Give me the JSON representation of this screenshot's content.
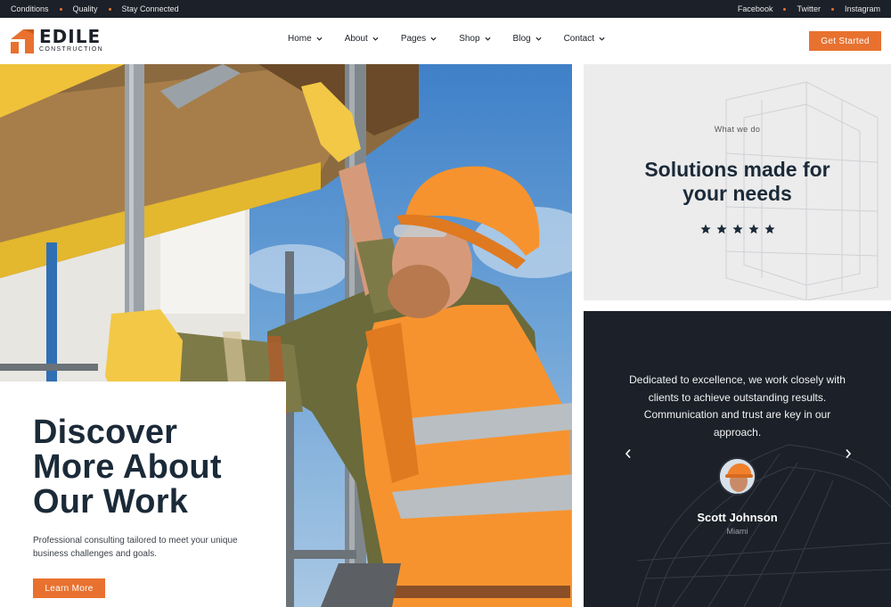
{
  "topbar": {
    "left_links": [
      "Conditions",
      "Quality",
      "Stay Connected"
    ],
    "right_links": [
      "Facebook",
      "Twitter",
      "Instagram"
    ]
  },
  "brand": {
    "name": "EDILE",
    "tagline": "CONSTRUCTION",
    "icon": "house-logo-icon",
    "accent_color": "#e8712f",
    "dark_color": "#1b2029"
  },
  "nav": {
    "items": [
      {
        "label": "Home"
      },
      {
        "label": "About"
      },
      {
        "label": "Pages"
      },
      {
        "label": "Shop"
      },
      {
        "label": "Blog"
      },
      {
        "label": "Contact"
      }
    ],
    "cta_label": "Get Started"
  },
  "hero": {
    "image": "construction-worker-on-scaffolding",
    "title_lines": [
      "Discover",
      "More About",
      "Our Work"
    ],
    "description": "Professional consulting tailored to meet your unique business challenges and goals.",
    "button_label": "Learn More"
  },
  "services": {
    "eyebrow": "What we do",
    "title_lines": [
      "Solutions made for",
      "your needs"
    ],
    "rating": 5
  },
  "testimonial": {
    "quote": "Dedicated to excellence, we work closely with clients to achieve outstanding results. Communication and trust are key in our approach.",
    "name": "Scott Johnson",
    "city": "Miami",
    "prev_icon": "chevron-left-icon",
    "next_icon": "chevron-right-icon"
  }
}
